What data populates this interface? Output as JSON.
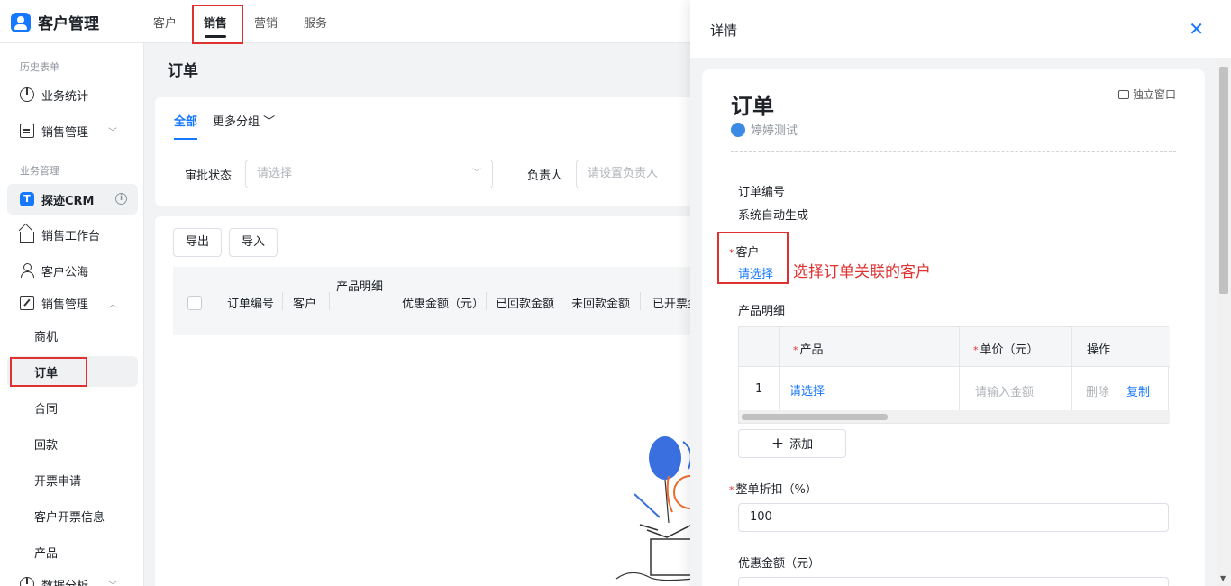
{
  "app": {
    "title": "客户管理"
  },
  "top_tabs": [
    {
      "label": "客户"
    },
    {
      "label": "销售"
    },
    {
      "label": "营销"
    },
    {
      "label": "服务"
    }
  ],
  "sidebar": {
    "group_history": "历史表单",
    "item_stats": "业务统计",
    "item_sales_mgmt_top": "销售管理",
    "group_business": "业务管理",
    "crm": {
      "badge": "T",
      "label": "探迹CRM",
      "info": "i"
    },
    "item_workbench": "销售工作台",
    "item_public_pool": "客户公海",
    "item_sales_mgmt": "销售管理",
    "sub_items": [
      "商机",
      "订单",
      "合同",
      "回款",
      "开票申请",
      "客户开票信息",
      "产品"
    ],
    "item_analysis": "数据分析"
  },
  "main": {
    "title": "订单",
    "filter_tabs": {
      "all": "全部",
      "more": "更多分组"
    },
    "filters": [
      {
        "label": "审批状态",
        "placeholder": "请选择"
      },
      {
        "label": "负责人",
        "placeholder": "请设置负责人"
      }
    ],
    "buttons": {
      "export": "导出",
      "import": "导入"
    },
    "columns": [
      "订单编号",
      "客户",
      "产品明细",
      "优惠金额（元）",
      "已回款金额",
      "未回款金额",
      "已开票金"
    ]
  },
  "drawer": {
    "title": "详情",
    "form_title": "订单",
    "creator": "婷婷测试",
    "popout": "独立窗口",
    "order_no": {
      "label": "订单编号",
      "value": "系统自动生成"
    },
    "customer": {
      "label": "客户",
      "value": "请选择"
    },
    "annotation": "选择订单关联的客户",
    "product_detail": {
      "label": "产品明细",
      "headers": {
        "product": "产品",
        "price": "单价（元）",
        "action": "操作"
      },
      "row": {
        "index": "1",
        "product": "请选择",
        "price_placeholder": "请输入金额",
        "delete": "删除",
        "copy": "复制"
      }
    },
    "add_button": "添加",
    "discount": {
      "label": "整单折扣（%）",
      "value": "100"
    },
    "coupon": {
      "label": "优惠金额（元）"
    }
  },
  "colors": {
    "accent": "#1677ff",
    "annotation": "#e03131"
  }
}
